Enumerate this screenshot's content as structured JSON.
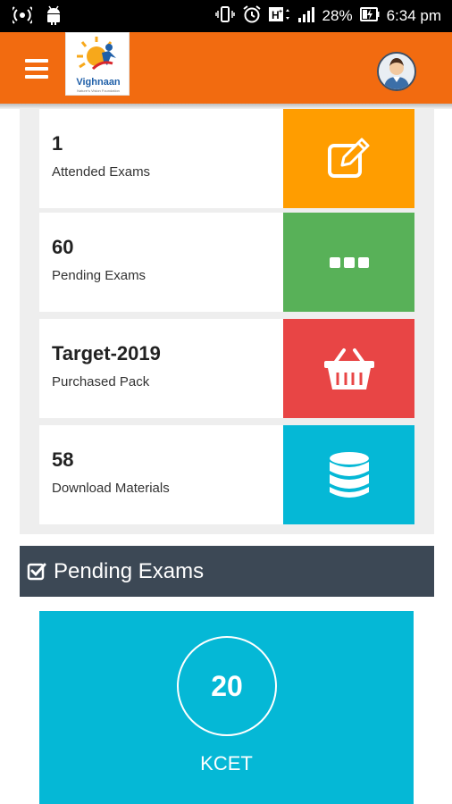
{
  "status_bar": {
    "battery": "28%",
    "time": "6:34 pm"
  },
  "app_bar": {
    "logo_name": "Vighnaan",
    "logo_tagline": "Nature's Vision Foundation"
  },
  "stats": [
    {
      "value": "1",
      "label": "Attended Exams",
      "icon": "edit-icon",
      "color": "#ff9d00"
    },
    {
      "value": "60",
      "label": "Pending Exams",
      "icon": "ellipsis-icon",
      "color": "#58b158"
    },
    {
      "value": "Target-2019",
      "label": "Purchased Pack",
      "icon": "basket-icon",
      "color": "#e84545"
    },
    {
      "value": "58",
      "label": "Download Materials",
      "icon": "database-icon",
      "color": "#05b8d6"
    }
  ],
  "pending_section": {
    "title": "Pending Exams",
    "exams": [
      {
        "count": "20",
        "name": "KCET"
      }
    ]
  },
  "colors": {
    "app_bar": "#f26b10",
    "section_header": "#3c4855",
    "exam_card": "#05b8d6"
  }
}
